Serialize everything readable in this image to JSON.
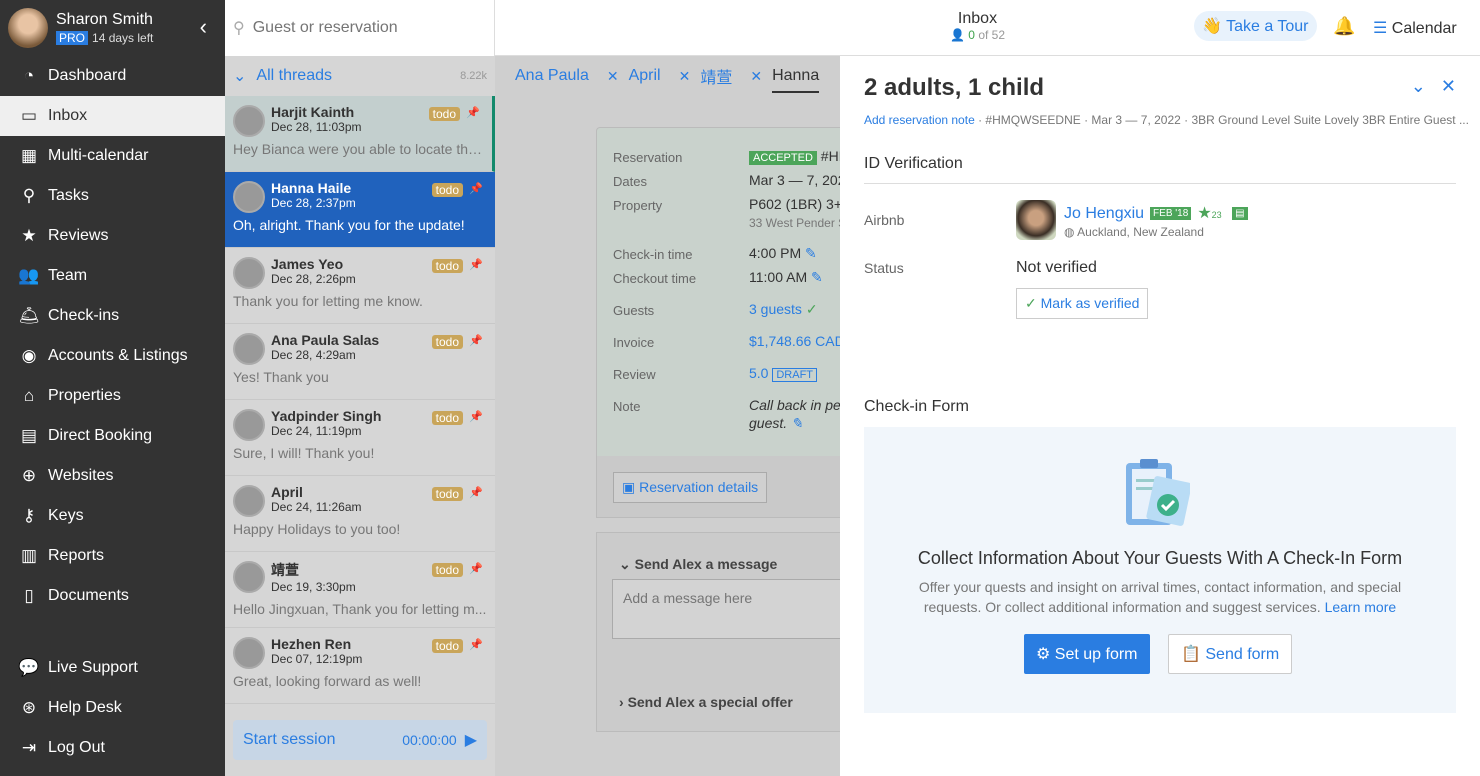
{
  "user": {
    "name": "Sharon Smith",
    "plan": "PRO",
    "trial": "14 days left"
  },
  "nav": [
    {
      "label": "Dashboard",
      "icon": "dashboard-icon",
      "glyph": "◔"
    },
    {
      "label": "Inbox",
      "icon": "inbox-icon",
      "glyph": "▭"
    },
    {
      "label": "Multi-calendar",
      "icon": "calendar-icon",
      "glyph": "▦"
    },
    {
      "label": "Tasks",
      "icon": "tasks-icon",
      "glyph": "⚲"
    },
    {
      "label": "Reviews",
      "icon": "star-icon",
      "glyph": "★"
    },
    {
      "label": "Team",
      "icon": "team-icon",
      "glyph": "👥"
    },
    {
      "label": "Check-ins",
      "icon": "bell-service-icon",
      "glyph": "🛎"
    },
    {
      "label": "Accounts & Listings",
      "icon": "account-icon",
      "glyph": "◉"
    },
    {
      "label": "Properties",
      "icon": "home-icon",
      "glyph": "⌂"
    },
    {
      "label": "Direct Booking",
      "icon": "code-window-icon",
      "glyph": "▤"
    },
    {
      "label": "Websites",
      "icon": "globe-icon",
      "glyph": "⊕"
    },
    {
      "label": "Keys",
      "icon": "key-icon",
      "glyph": "⚷"
    },
    {
      "label": "Reports",
      "icon": "reports-icon",
      "glyph": "▥"
    },
    {
      "label": "Documents",
      "icon": "document-icon",
      "glyph": "▯"
    }
  ],
  "nav_bottom": [
    {
      "label": "Live Support",
      "icon": "chat-icon",
      "glyph": "💬"
    },
    {
      "label": "Help Desk",
      "icon": "lifebuoy-icon",
      "glyph": "⊛"
    },
    {
      "label": "Log Out",
      "icon": "logout-icon",
      "glyph": "⇥"
    }
  ],
  "search": {
    "placeholder": "Guest or reservation"
  },
  "threads_header": {
    "label": "All threads",
    "count": "8.22k"
  },
  "threads": [
    {
      "name": "Harjit Kainth",
      "date": "Dec 28, 11:03pm",
      "preview": "Hey Bianca were you able to locate that...",
      "badge": "todo"
    },
    {
      "name": "Hanna Haile",
      "date": "Dec 28, 2:37pm",
      "preview": "Oh, alright. Thank you for the update!",
      "badge": "todo"
    },
    {
      "name": "James Yeo",
      "date": "Dec 28, 2:26pm",
      "preview": "Thank you for letting me know.",
      "badge": "todo"
    },
    {
      "name": "Ana Paula Salas",
      "date": "Dec 28, 4:29am",
      "preview": "Yes! Thank you",
      "badge": "todo"
    },
    {
      "name": "Yadpinder Singh",
      "date": "Dec 24, 11:19pm",
      "preview": "Sure, I will! Thank you!",
      "badge": "todo"
    },
    {
      "name": "April",
      "date": "Dec 24, 11:26am",
      "preview": "Happy Holidays to you too!",
      "badge": "todo"
    },
    {
      "name": "靖萱",
      "date": "Dec 19, 3:30pm",
      "preview": "Hello Jingxuan, Thank you for letting m...",
      "badge": "todo"
    },
    {
      "name": "Hezhen Ren",
      "date": "Dec 07, 12:19pm",
      "preview": "Great, looking forward as well!",
      "badge": "todo"
    }
  ],
  "session": {
    "label": "Start session",
    "time": "00:00:00"
  },
  "header": {
    "title": "Inbox",
    "count": "0",
    "of": "of 52",
    "tour": "Take a Tour",
    "calendar": "Calendar"
  },
  "tabs": [
    "Ana Paula",
    "April",
    "靖萱",
    "Hanna"
  ],
  "reservation": {
    "labels": {
      "reservation": "Reservation",
      "dates": "Dates",
      "property": "Property",
      "checkin": "Check-in time",
      "checkout": "Checkout time",
      "guests": "Guests",
      "invoice": "Invoice",
      "review": "Review",
      "note": "Note"
    },
    "status": "ACCEPTED",
    "code": "#HM",
    "dates": "Mar 3 — 7, 202",
    "property": "P602 (1BR) 3+",
    "address": "33 West Pender S",
    "checkin": "4:00 PM",
    "checkout": "11:00 AM",
    "guests": "3 guests",
    "invoice": "$1,748.66 CAD",
    "review": "5.0",
    "review_status": "DRAFT",
    "note1": "Call back in pers",
    "note2": "guest.",
    "details_button": "Reservation details"
  },
  "message": {
    "header": "Send Alex a message",
    "placeholder": "Add a message here",
    "offer": "Send Alex a special offer"
  },
  "panel": {
    "title": "2 adults, 1 child",
    "add_note": "Add reservation note",
    "meta": " · #HMQWSEEDNE · Mar 3 — 7, 2022 · 3BR Ground Level Suite Lovely 3BR Entire Guest ...",
    "id_section": "ID Verification",
    "source": "Airbnb",
    "guest": {
      "name": "Jo Hengxiu",
      "since": "FEB '18",
      "reviews": "23",
      "location": "Auckland, New Zealand"
    },
    "status_label": "Status",
    "status": "Not verified",
    "verify_button": "Mark as verified",
    "checkin_section": "Check-in Form",
    "cta_title": "Collect Information About Your Guests With A Check-In Form",
    "cta_text": "Offer your quests and insight on arrival times, contact information, and special requests. Or collect additional information and suggest services.",
    "learn_more": "Learn more",
    "setup_button": "Set up form",
    "send_button": "Send form"
  },
  "colors": {
    "accent": "#2a7de1",
    "success": "#4ca55a",
    "todo": "#c9a55a",
    "sidebar": "#333333",
    "selected": "#2062bd"
  }
}
